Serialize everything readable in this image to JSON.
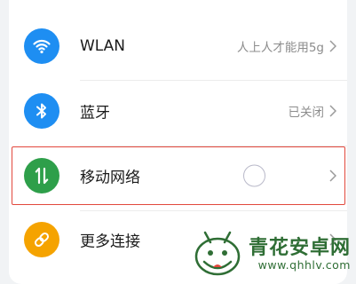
{
  "settings": {
    "items": [
      {
        "label": "WLAN",
        "value": "人上人才能用5g",
        "icon": "wifi-icon",
        "color": "#1e8ef2"
      },
      {
        "label": "蓝牙",
        "value": "已关闭",
        "icon": "bluetooth-icon",
        "color": "#1e8ef2"
      },
      {
        "label": "移动网络",
        "value": "",
        "icon": "mobile-data-icon",
        "color": "#2e9f4a"
      },
      {
        "label": "更多连接",
        "value": "",
        "icon": "link-icon",
        "color": "#f5a300"
      }
    ]
  },
  "watermark": {
    "name": "青花安卓网",
    "url": "www.qhhlv.com"
  },
  "colors": {
    "highlight": "#e2483d"
  }
}
